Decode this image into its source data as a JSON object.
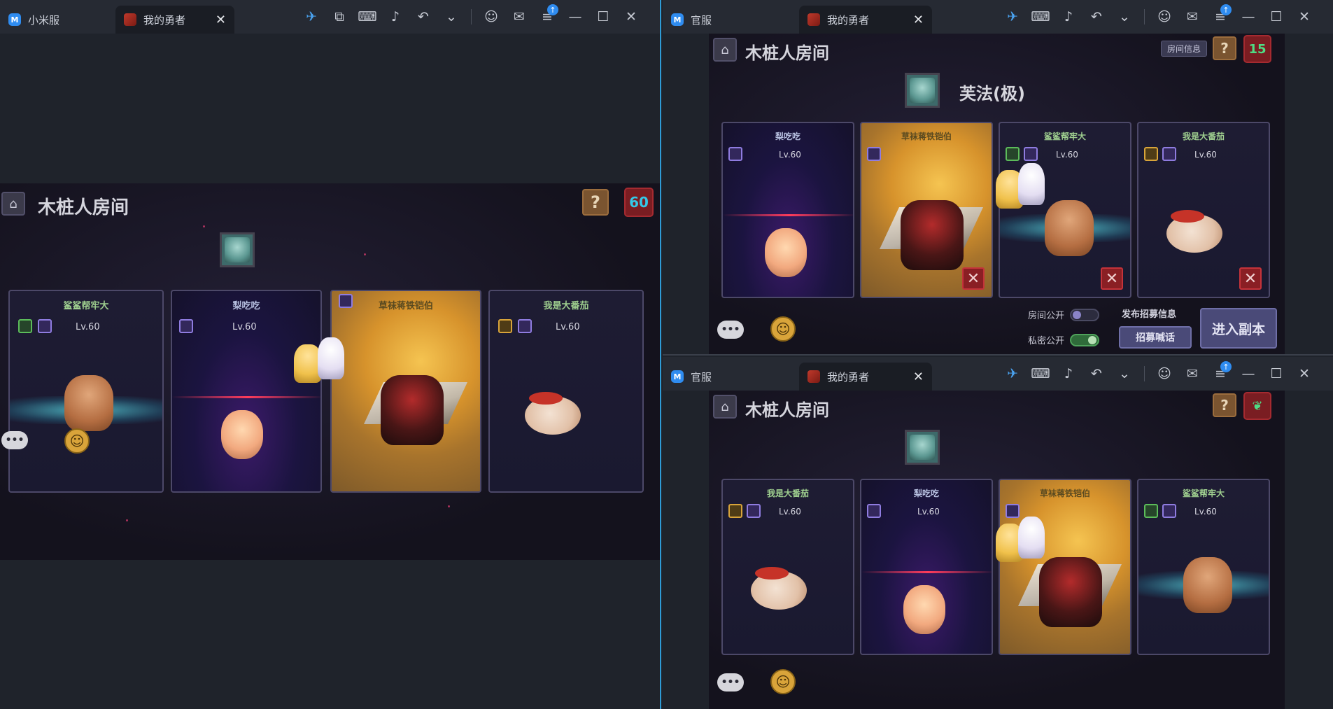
{
  "left_window": {
    "tab_inactive": "小米服",
    "tab_active": "我的勇者",
    "game": {
      "title": "木桩人房间",
      "help": "?",
      "counter": "60",
      "cards": [
        {
          "name": "鲨鲨帮牢大",
          "level": "Lv.60"
        },
        {
          "name": "梨吃吃",
          "level": "Lv.60"
        },
        {
          "name": "草袜蒋铁铠伯",
          "level": ""
        },
        {
          "name": "我是大番茄",
          "level": "Lv.60"
        }
      ],
      "chat": "•••",
      "emoji": "☺"
    }
  },
  "top_right_window": {
    "tab_inactive": "官服",
    "tab_active": "我的勇者",
    "game": {
      "title": "木桩人房间",
      "room_info": "房间信息",
      "help": "?",
      "counter": "15",
      "boss_name": "芙法(极)",
      "cards": [
        {
          "name": "梨吃吃",
          "level": "Lv.60"
        },
        {
          "name": "草袜蒋铁铠伯",
          "level": ""
        },
        {
          "name": "鲨鲨帮牢大",
          "level": "Lv.60"
        },
        {
          "name": "我是大番茄",
          "level": "Lv.60"
        }
      ],
      "room_public_label": "房间公开",
      "private_public_label": "私密公开",
      "publish_label": "发布招募信息",
      "recruit_button": "招募喊话",
      "enter_button": "进入副本",
      "chat": "•••",
      "emoji": "☺"
    }
  },
  "bottom_right_window": {
    "tab_inactive": "官服",
    "tab_active": "我的勇者",
    "game": {
      "title": "木桩人房间",
      "help": "?",
      "cards": [
        {
          "name": "我是大番茄",
          "level": "Lv.60"
        },
        {
          "name": "梨吃吃",
          "level": "Lv.60"
        },
        {
          "name": "草袜蒋铁铠伯",
          "level": ""
        },
        {
          "name": "鲨鲨帮牢大",
          "level": "Lv.60"
        }
      ],
      "chat": "•••",
      "emoji": "☺"
    }
  },
  "icons": {
    "close": "✕",
    "minimize": "—",
    "maximize": "☐",
    "undo": "↶",
    "chevron": "⌄",
    "home": "⌂",
    "kick": "✕"
  },
  "colors": {
    "accent_blue": "#2f8cf0",
    "counter_cyan": "#34c8e8",
    "counter_green": "#4fdc84",
    "kick_red": "#8a1f24"
  }
}
